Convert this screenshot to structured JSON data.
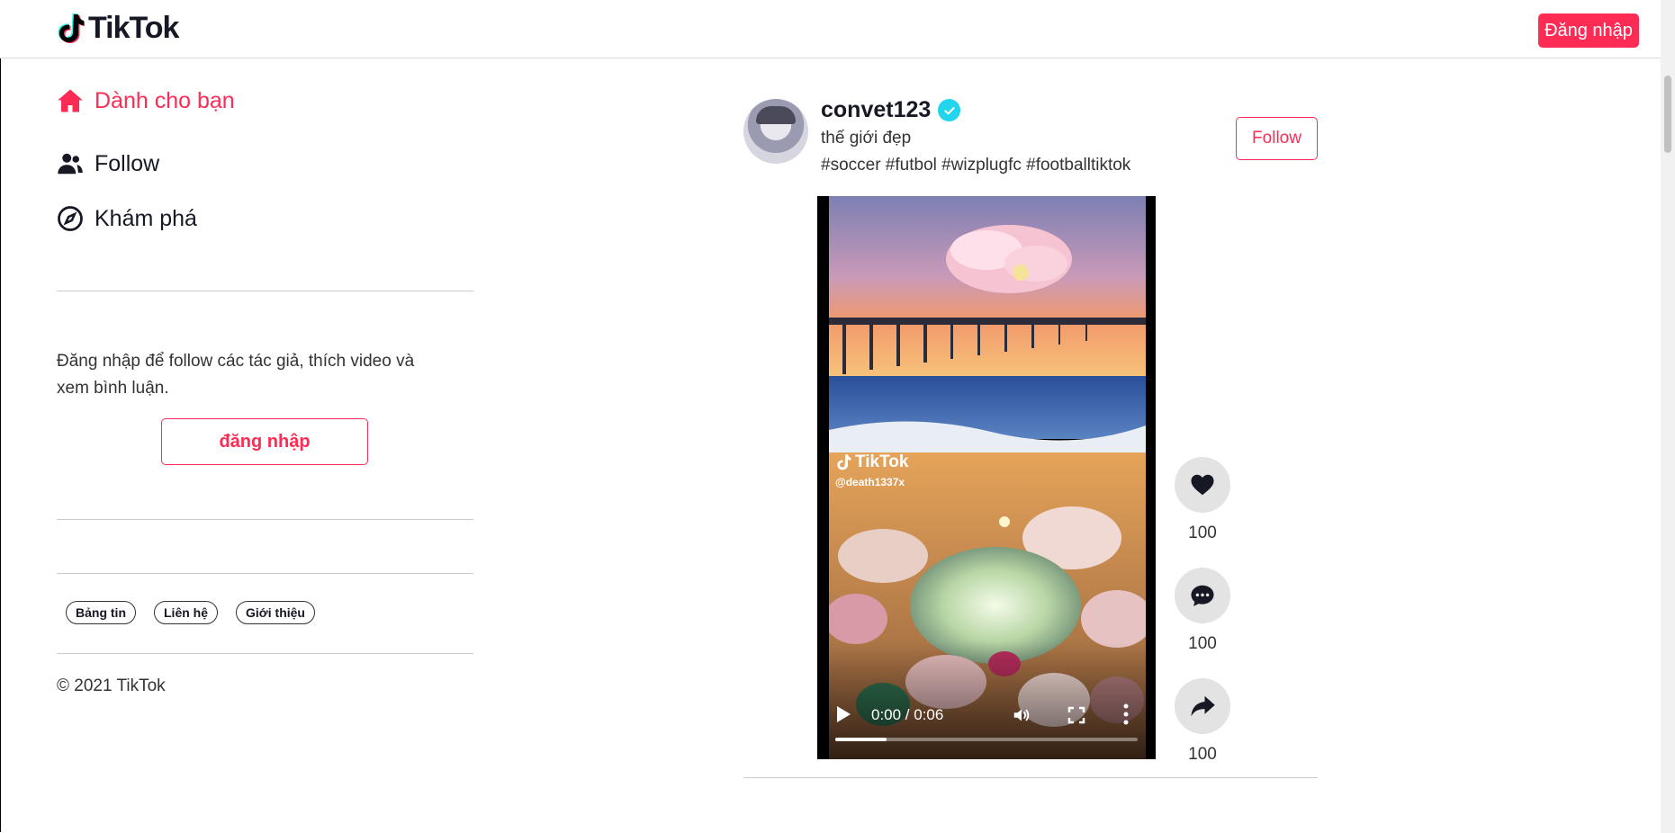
{
  "header": {
    "logo_text": "TikTok",
    "login_label": "Đăng nhập"
  },
  "sidebar": {
    "items": [
      {
        "label": "Dành cho bạn",
        "icon": "home-icon",
        "active": true
      },
      {
        "label": "Follow",
        "icon": "users-icon",
        "active": false
      },
      {
        "label": "Khám phá",
        "icon": "compass-icon",
        "active": false
      }
    ],
    "login_hint": "Đăng nhập để follow các tác giả, thích video và xem bình luận.",
    "login_button": "đăng nhập",
    "footer_links": [
      "Bảng tin",
      "Liên hệ",
      "Giới thiệu"
    ],
    "copyright": "© 2021 TikTok"
  },
  "post": {
    "username": "convet123",
    "verified": true,
    "caption": "thế giới đẹp",
    "hashtags": "#soccer #futbol #wizplugfc #footballtiktok",
    "follow_label": "Follow",
    "video": {
      "watermark_logo": "TikTok",
      "watermark_user": "@death1337x",
      "time": "0:00 / 0:06",
      "progress": 0.17
    },
    "actions": [
      {
        "name": "like",
        "icon": "heart-icon",
        "count": "100"
      },
      {
        "name": "comment",
        "icon": "comment-icon",
        "count": "100"
      },
      {
        "name": "share",
        "icon": "share-icon",
        "count": "100"
      }
    ]
  },
  "colors": {
    "brand": "#fe2c55",
    "verified": "#20d5ec"
  }
}
